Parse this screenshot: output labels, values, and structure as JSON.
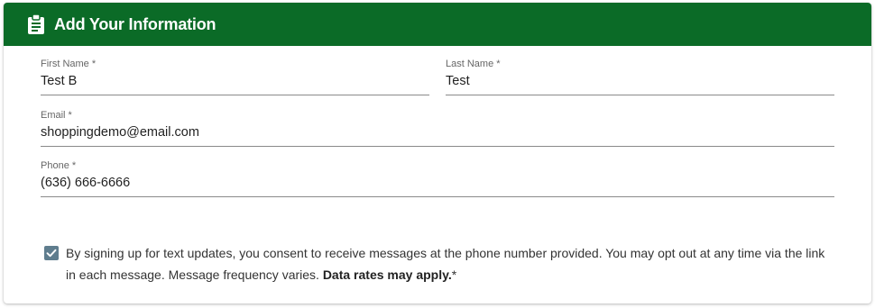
{
  "header": {
    "title": "Add Your Information",
    "icon": "clipboard-icon",
    "background_color": "#0b6b27"
  },
  "form": {
    "first_name": {
      "label": "First Name *",
      "value": "Test B"
    },
    "last_name": {
      "label": "Last Name *",
      "value": "Test"
    },
    "email": {
      "label": "Email *",
      "value": "shoppingdemo@email.com"
    },
    "phone": {
      "label": "Phone *",
      "value": "(636) 666-6666"
    }
  },
  "consent": {
    "checked": true,
    "checkbox_color": "#5f7d8e",
    "text": "By signing up for text updates, you consent to receive messages at the phone number provided. You may opt out at any time via the link in each message. Message frequency varies. ",
    "bold_text": "Data rates may apply.",
    "suffix": "*"
  }
}
